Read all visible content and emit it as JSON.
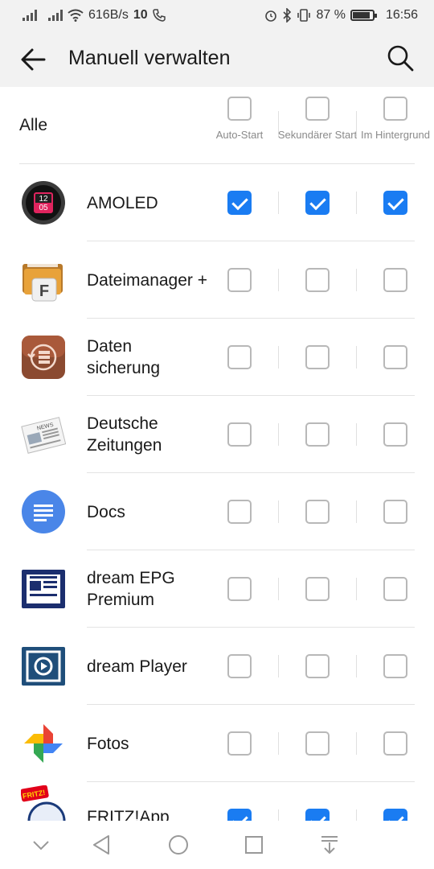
{
  "status_bar": {
    "network_speed": "616B/s",
    "notification_count": "10",
    "battery_percent": "87 %",
    "battery_level": 0.87,
    "time": "16:56",
    "icons": [
      "signal-icon",
      "wifi-icon",
      "phone-icon",
      "alarm-icon",
      "bluetooth-icon",
      "vibrate-icon",
      "battery-icon"
    ]
  },
  "app_bar": {
    "title": "Manuell verwalten",
    "back_icon": "arrow-left-icon",
    "search_icon": "search-icon"
  },
  "header_row": {
    "label": "Alle",
    "columns": [
      {
        "label": "Auto-Start",
        "checked": false
      },
      {
        "label": "Sekundärer Start",
        "checked": false
      },
      {
        "label": "Im Hintergrund",
        "checked": false
      }
    ]
  },
  "apps": [
    {
      "name": "AMOLED",
      "icon": "amoled-clock-icon",
      "clock_hour": "12",
      "clock_minute": "05",
      "auto_start": true,
      "secondary_start": true,
      "background": true
    },
    {
      "name": "Dateimanager +",
      "icon": "file-manager-icon",
      "icon_letter": "F",
      "auto_start": false,
      "secondary_start": false,
      "background": false
    },
    {
      "name": "Daten sicherung",
      "icon": "backup-icon",
      "auto_start": false,
      "secondary_start": false,
      "background": false
    },
    {
      "name": "Deutsche Zeitungen",
      "icon": "newspaper-icon",
      "icon_text": "NEWS",
      "auto_start": false,
      "secondary_start": false,
      "background": false
    },
    {
      "name": "Docs",
      "icon": "docs-icon",
      "auto_start": false,
      "secondary_start": false,
      "background": false
    },
    {
      "name": "dream EPG Premium",
      "icon": "dream-epg-icon",
      "auto_start": false,
      "secondary_start": false,
      "background": false
    },
    {
      "name": "dream Player",
      "icon": "dream-player-icon",
      "auto_start": false,
      "secondary_start": false,
      "background": false
    },
    {
      "name": "Fotos",
      "icon": "photos-pinwheel-icon",
      "auto_start": false,
      "secondary_start": false,
      "background": false
    },
    {
      "name": "FRITZ!App",
      "icon": "fritz-app-icon",
      "icon_text": "FRITZ!",
      "auto_start": true,
      "secondary_start": true,
      "background": true
    }
  ],
  "nav_bar": {
    "buttons": [
      "chevron-down-icon",
      "back-triangle-icon",
      "home-circle-icon",
      "recents-square-icon",
      "notification-pull-icon"
    ]
  },
  "colors": {
    "accent": "#1a7cf2",
    "checkbox_border": "#b8b8b8",
    "header_background": "#f2f2f2",
    "content_background": "#ffffff"
  }
}
